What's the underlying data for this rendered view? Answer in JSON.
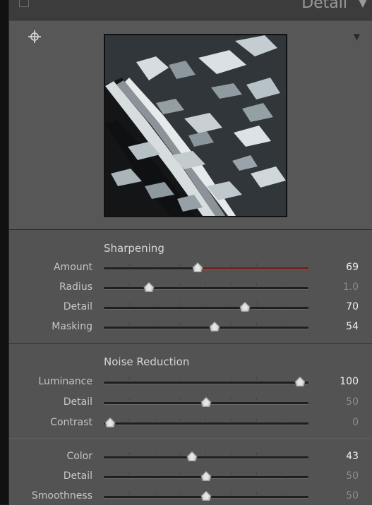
{
  "header": {
    "title": "Detail",
    "arrow": "▼"
  },
  "preview": {
    "menu_arrow": "▼",
    "target_icon": "target-icon"
  },
  "sharpening": {
    "title": "Sharpening",
    "rows": [
      {
        "label": "Amount",
        "value": "69",
        "fraction": 0.46,
        "dim": false,
        "fill": true
      },
      {
        "label": "Radius",
        "value": "1.0",
        "fraction": 0.22,
        "dim": true,
        "fill": false
      },
      {
        "label": "Detail",
        "value": "70",
        "fraction": 0.69,
        "dim": false,
        "fill": false
      },
      {
        "label": "Masking",
        "value": "54",
        "fraction": 0.54,
        "dim": false,
        "fill": false
      }
    ]
  },
  "noise_reduction": {
    "title": "Noise Reduction",
    "rows": [
      {
        "label": "Luminance",
        "value": "100",
        "fraction": 0.96,
        "dim": false,
        "fill": false
      },
      {
        "label": "Detail",
        "value": "50",
        "fraction": 0.5,
        "dim": true,
        "fill": false
      },
      {
        "label": "Contrast",
        "value": "0",
        "fraction": 0.03,
        "dim": true,
        "fill": false
      }
    ]
  },
  "color_group": {
    "rows": [
      {
        "label": "Color",
        "value": "43",
        "fraction": 0.43,
        "dim": false,
        "fill": false
      },
      {
        "label": "Detail",
        "value": "50",
        "fraction": 0.5,
        "dim": true,
        "fill": false
      },
      {
        "label": "Smoothness",
        "value": "50",
        "fraction": 0.5,
        "dim": true,
        "fill": false
      }
    ]
  }
}
